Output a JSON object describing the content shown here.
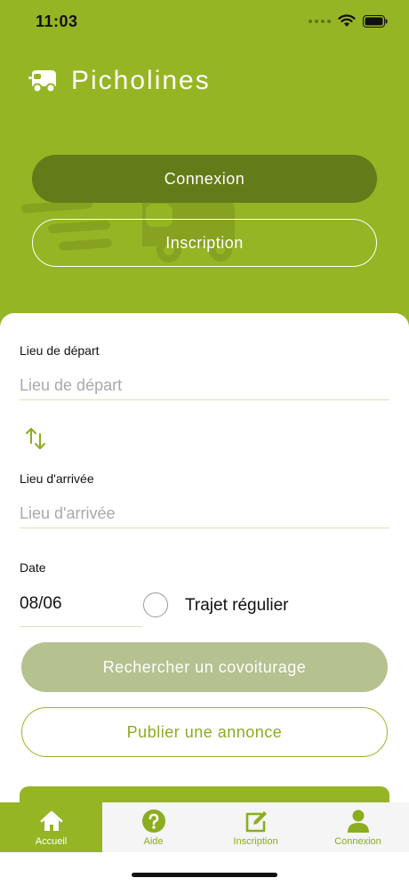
{
  "status_bar": {
    "time": "11:03"
  },
  "brand": {
    "title": "Picholines"
  },
  "auth": {
    "login_label": "Connexion",
    "register_label": "Inscription"
  },
  "form": {
    "departure": {
      "label": "Lieu de départ",
      "placeholder": "Lieu de départ"
    },
    "arrival": {
      "label": "Lieu d'arrivée",
      "placeholder": "Lieu d'arrivée"
    },
    "date": {
      "label": "Date",
      "value": "08/06"
    },
    "regular_trip": {
      "label": "Trajet régulier",
      "checked": false
    },
    "search_label": "Rechercher un covoiturage",
    "publish_label": "Publier une annonce"
  },
  "tabs": [
    {
      "label": "Accueil",
      "icon": "home-icon",
      "active": true
    },
    {
      "label": "Aide",
      "icon": "help-icon",
      "active": false
    },
    {
      "label": "Inscription",
      "icon": "edit-icon",
      "active": false
    },
    {
      "label": "Connexion",
      "icon": "user-icon",
      "active": false
    }
  ],
  "colors": {
    "brand_green": "#95b525",
    "dark_green": "#647b19",
    "disabled_green": "#b5c18f",
    "tab_bg": "#f4f5f4"
  }
}
